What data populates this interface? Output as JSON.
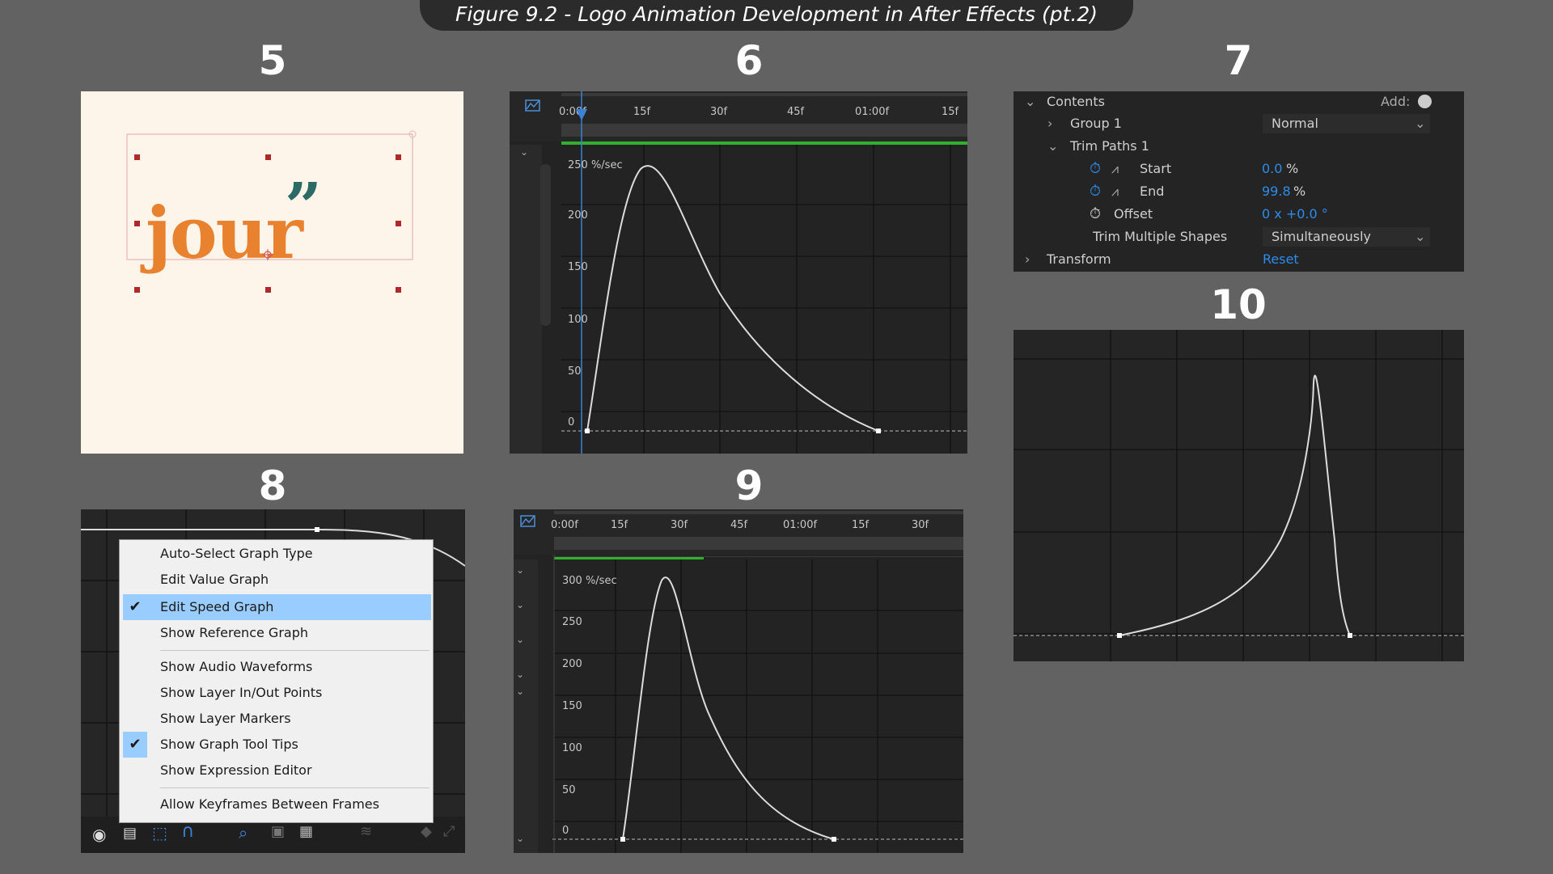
{
  "banner": {
    "title": "Figure 9.2 - Logo Animation Development in After Effects (pt.2)"
  },
  "steps": {
    "s5": "5",
    "s6": "6",
    "s7": "7",
    "s8": "8",
    "s9": "9",
    "s10": "10"
  },
  "panel5": {
    "logo_text": "jour",
    "logo_mark": "”"
  },
  "panel6": {
    "ticks": [
      "0:00f",
      "15f",
      "30f",
      "45f",
      "01:00f",
      "15f"
    ],
    "y_labels": [
      "250 %/sec",
      "200",
      "150",
      "100",
      "50",
      "0"
    ]
  },
  "panel7": {
    "contents": "Contents",
    "add": "Add:",
    "group1": "Group 1",
    "blend_mode": "Normal",
    "trim_paths": "Trim Paths 1",
    "start_label": "Start",
    "start_value": "0.0",
    "end_label": "End",
    "end_value": "99.8",
    "percent": "%",
    "offset_label": "Offset",
    "offset_value": "0 x +0.0 °",
    "trim_multiple": "Trim Multiple Shapes",
    "trim_multiple_value": "Simultaneously",
    "transform": "Transform",
    "reset": "Reset"
  },
  "panel8": {
    "menu": [
      {
        "label": "Auto-Select Graph Type",
        "checked": false
      },
      {
        "label": "Edit Value Graph",
        "checked": false
      },
      {
        "label": "Edit Speed Graph",
        "checked": true,
        "highlighted": true
      },
      {
        "label": "Show Reference Graph",
        "checked": false
      },
      {
        "label": "Show Audio Waveforms",
        "checked": false
      },
      {
        "label": "Show Layer In/Out Points",
        "checked": false
      },
      {
        "label": "Show Layer Markers",
        "checked": false
      },
      {
        "label": "Show Graph Tool Tips",
        "checked": true
      },
      {
        "label": "Show Expression Editor",
        "checked": false
      },
      {
        "label": "Allow Keyframes Between Frames",
        "checked": false
      }
    ],
    "check_glyph": "✔"
  },
  "panel9": {
    "ticks": [
      "0:00f",
      "15f",
      "30f",
      "45f",
      "01:00f",
      "15f",
      "30f"
    ],
    "y_labels": [
      "300 %/sec",
      "250",
      "200",
      "150",
      "100",
      "50",
      "0"
    ]
  },
  "colors": {
    "accent": "#2d8ceb",
    "green_bar": "#2fb12f",
    "logo_orange": "#e8822e",
    "logo_teal": "#2c6a66",
    "canvas": "#fdf4ea"
  }
}
